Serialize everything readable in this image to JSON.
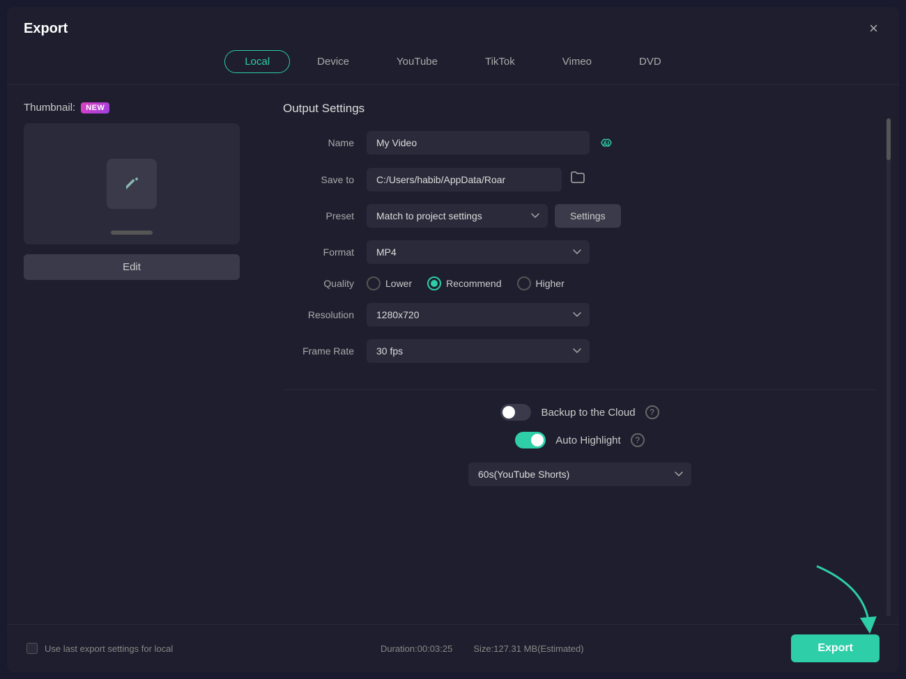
{
  "dialog": {
    "title": "Export",
    "close_label": "×"
  },
  "tabs": [
    {
      "id": "local",
      "label": "Local",
      "active": true
    },
    {
      "id": "device",
      "label": "Device",
      "active": false
    },
    {
      "id": "youtube",
      "label": "YouTube",
      "active": false
    },
    {
      "id": "tiktok",
      "label": "TikTok",
      "active": false
    },
    {
      "id": "vimeo",
      "label": "Vimeo",
      "active": false
    },
    {
      "id": "dvd",
      "label": "DVD",
      "active": false
    }
  ],
  "left": {
    "thumbnail_label": "Thumbnail:",
    "new_badge": "NEW",
    "edit_btn": "Edit"
  },
  "right": {
    "section_title": "Output Settings",
    "name_label": "Name",
    "name_value": "My Video",
    "save_to_label": "Save to",
    "save_to_value": "C:/Users/habib/AppData/Roar",
    "preset_label": "Preset",
    "preset_value": "Match to project settings",
    "settings_btn": "Settings",
    "format_label": "Format",
    "format_value": "MP4",
    "quality_label": "Quality",
    "quality_options": [
      {
        "label": "Lower",
        "checked": false
      },
      {
        "label": "Recommend",
        "checked": true
      },
      {
        "label": "Higher",
        "checked": false
      }
    ],
    "resolution_label": "Resolution",
    "resolution_value": "1280x720",
    "frame_rate_label": "Frame Rate",
    "frame_rate_value": "30 fps",
    "backup_label": "Backup to the Cloud",
    "backup_on": false,
    "auto_highlight_label": "Auto Highlight",
    "auto_highlight_on": true,
    "shorts_value": "60s(YouTube Shorts)"
  },
  "bottom": {
    "use_last_label": "Use last export settings for local",
    "duration_label": "Duration:00:03:25",
    "size_label": "Size:127.31 MB(Estimated)",
    "export_btn": "Export"
  }
}
